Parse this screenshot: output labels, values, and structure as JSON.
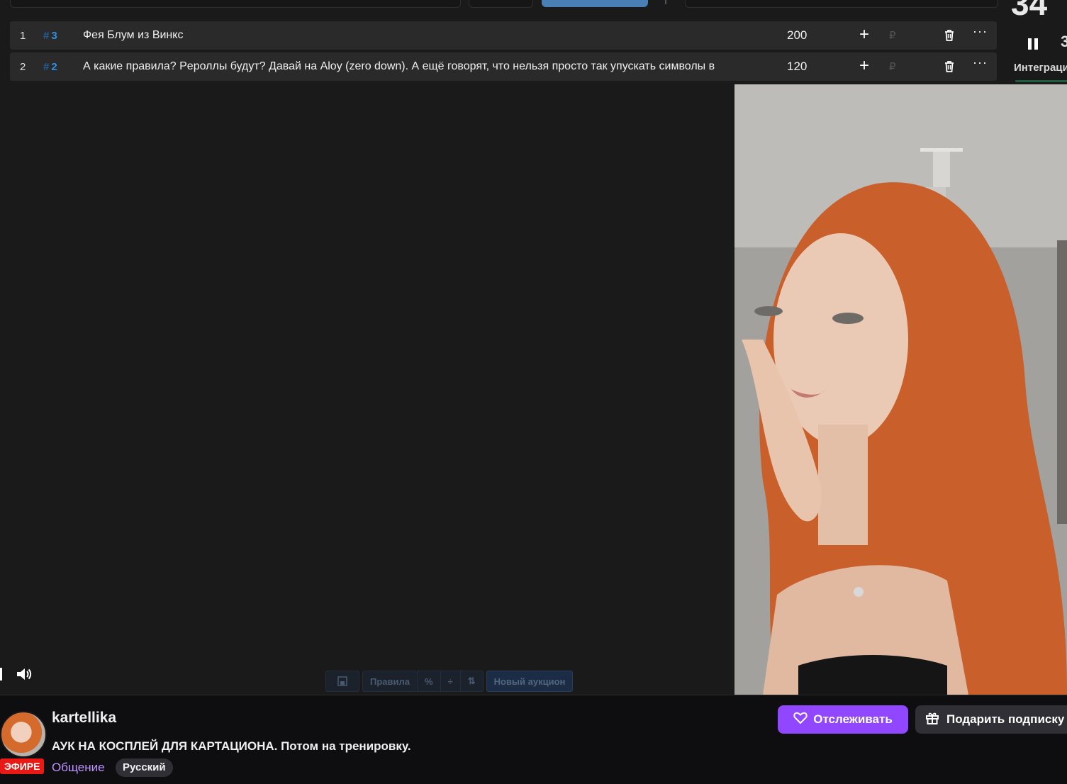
{
  "auction": {
    "lots": [
      {
        "index": "1",
        "tag": "3",
        "name": "Фея Блум из Винкс",
        "amount": "200",
        "currency": "₽"
      },
      {
        "index": "2",
        "tag": "2",
        "name": "А какие правила? Pероллы будут? Давай на Aloy (zero down). А ещё говорят, что нельзя просто так упускать символы в",
        "amount": "120",
        "currency": "₽"
      }
    ],
    "tag_prefix": "#",
    "add_label": "+",
    "more_label": "···",
    "timer_text": "34",
    "skip_glyph": "3",
    "integration_label": "Интеграци",
    "toolbar": {
      "rules_label": "Правила",
      "percent_label": "%",
      "divide_label": "÷",
      "sort_label": "⇅",
      "new_auction_label": "Новый аукцион"
    }
  },
  "stream": {
    "live_badge": "ЭФИРЕ",
    "channel_name": "kartellika",
    "title": "АУК НА КОСПЛЕЙ ДЛЯ КАРТАЦИОНА. Потом на тренировку.",
    "category": "Общение",
    "language_tag": "Русский",
    "follow_label": "Отслеживать",
    "gift_label": "Подарить подписку"
  },
  "colors": {
    "follow_button": "#9147ff",
    "live_badge": "#e91916",
    "category_link": "#bf94ff",
    "lot_tag": "#2f8fe6"
  },
  "icons": [
    "trash-icon",
    "more-icon",
    "pause-icon",
    "volume-icon",
    "heart-icon",
    "gift-icon",
    "save-icon"
  ]
}
